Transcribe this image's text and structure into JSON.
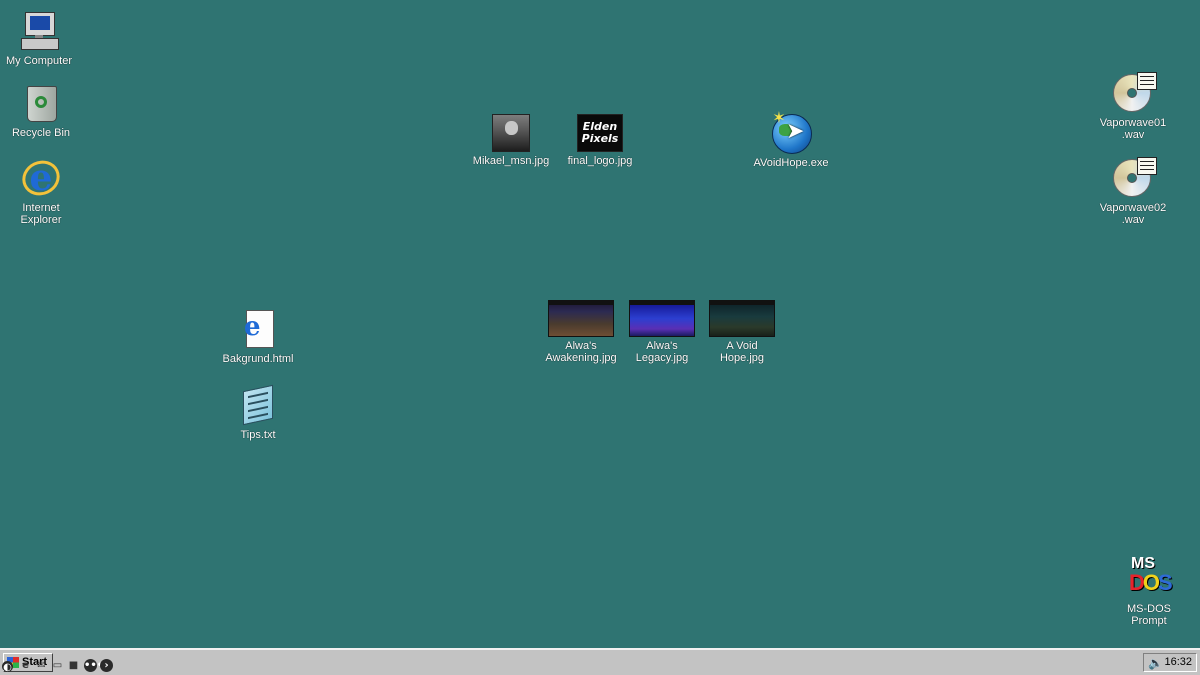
{
  "desktop": {
    "background_color": "#2f7472",
    "icons": {
      "my_computer": {
        "label": "My Computer",
        "icon": "computer-icon"
      },
      "recycle_bin": {
        "label": "Recycle Bin",
        "icon": "recycle-bin-icon"
      },
      "internet_explorer": {
        "label": "Internet\nExplorer",
        "icon": "internet-explorer-icon"
      },
      "mikael_msn": {
        "label": "Mikael_msn.jpg",
        "icon": "photo-thumbnail-icon"
      },
      "final_logo": {
        "label": "final_logo.jpg",
        "icon": "logo-thumbnail-icon",
        "thumb_text": "Elden\nPixels"
      },
      "avoidhope_exe": {
        "label": "AVoidHope.exe",
        "icon": "globe-cursor-icon"
      },
      "vaporwave01": {
        "label": "Vaporwave01\n.wav",
        "icon": "audio-cd-icon"
      },
      "vaporwave02": {
        "label": "Vaporwave02\n.wav",
        "icon": "audio-cd-icon"
      },
      "bakgrund_html": {
        "label": "Bakgrund.html",
        "icon": "html-document-icon"
      },
      "tips_txt": {
        "label": "Tips.txt",
        "icon": "notepad-icon"
      },
      "alwas_awakening": {
        "label": "Alwa's\nAwakening.jpg",
        "icon": "game-screenshot-icon"
      },
      "alwas_legacy": {
        "label": "Alwa's\nLegacy.jpg",
        "icon": "game-screenshot-icon"
      },
      "a_void_hope": {
        "label": "A Void\nHope.jpg",
        "icon": "game-screenshot-icon"
      },
      "ms_dos": {
        "label": "MS-DOS\nPrompt",
        "icon": "ms-dos-icon",
        "logo_top": "MS",
        "logo_letters": [
          "D",
          "O",
          "S"
        ]
      }
    }
  },
  "taskbar": {
    "start_label": "Start",
    "clock": "16:32",
    "quick_launch": [
      "desktop-icon",
      "internet-explorer-icon",
      "email-icon",
      "media-icon",
      "chat-icon",
      "forward-icon"
    ]
  }
}
